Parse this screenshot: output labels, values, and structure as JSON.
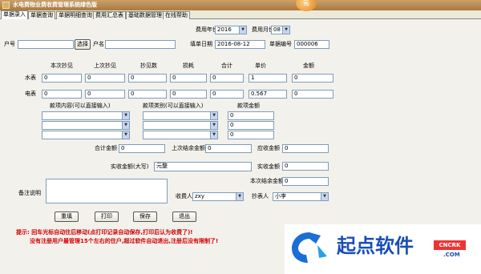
{
  "window": {
    "title": "水电费物业费收费管理系统绿色版",
    "orb_text": "元"
  },
  "tabs": [
    "单据录入",
    "单据查询",
    "单据明细查询",
    "费用汇总表",
    "基础数据管理",
    "在线帮助"
  ],
  "header": {
    "year_label": "费用年份",
    "year_value": "2016",
    "month_label": "费用月份",
    "month_value": "08",
    "account_label": "户号",
    "account_value": "",
    "select_button": "选择",
    "name_label": "户名",
    "name_value": "",
    "date_label": "填单日期",
    "date_value": "2016-08-12",
    "doc_no_label": "单据编号",
    "doc_no_value": "000006"
  },
  "meter": {
    "columns": [
      "本次抄见",
      "上次抄见",
      "抄见数",
      "损耗",
      "合计",
      "单价",
      "金额"
    ],
    "water_label": "水表",
    "water": [
      "0",
      "0",
      "0",
      "0",
      "0",
      "1",
      "0"
    ],
    "electric_label": "电表",
    "electric": [
      "0",
      "0",
      "0",
      "0",
      "0",
      "0.567",
      "0"
    ]
  },
  "items": {
    "content_header": "款项内容(可以直接输入)",
    "type_header": "款项类别(可以直接输入)",
    "amount_header": "款项金额",
    "amounts": [
      "0",
      "0",
      "0"
    ]
  },
  "totals": {
    "total_label": "合计金额",
    "total_value": "0",
    "prev_balance_label": "上次结余金额",
    "prev_balance_value": "0",
    "receivable_label": "应收金额",
    "receivable_value": "0",
    "paid_upper_label": "实收金额(大写)",
    "paid_upper_value": "元整",
    "paid_label": "实收金额",
    "paid_value": "0",
    "balance_label": "本次结余金额",
    "balance_value": "0"
  },
  "footer": {
    "remark_label": "备注说明",
    "collector_label": "收费人",
    "collector_value": "zxy",
    "copier_label": "抄表人",
    "copier_value": "小李",
    "buttons": {
      "refill": "重填",
      "print": "打印",
      "save": "保存",
      "exit": "退出"
    },
    "hint1": "提示: 回车光标自动往后移动(点打印记录自动保存,打印后认为收费了)!",
    "hint2": "没有注册用户最管理15个左右的住户,超过软件自动退出,注册后没有限制了!"
  },
  "watermark": {
    "text": "起点软件",
    "badge": "CNCRK",
    "domain": ".COM"
  }
}
